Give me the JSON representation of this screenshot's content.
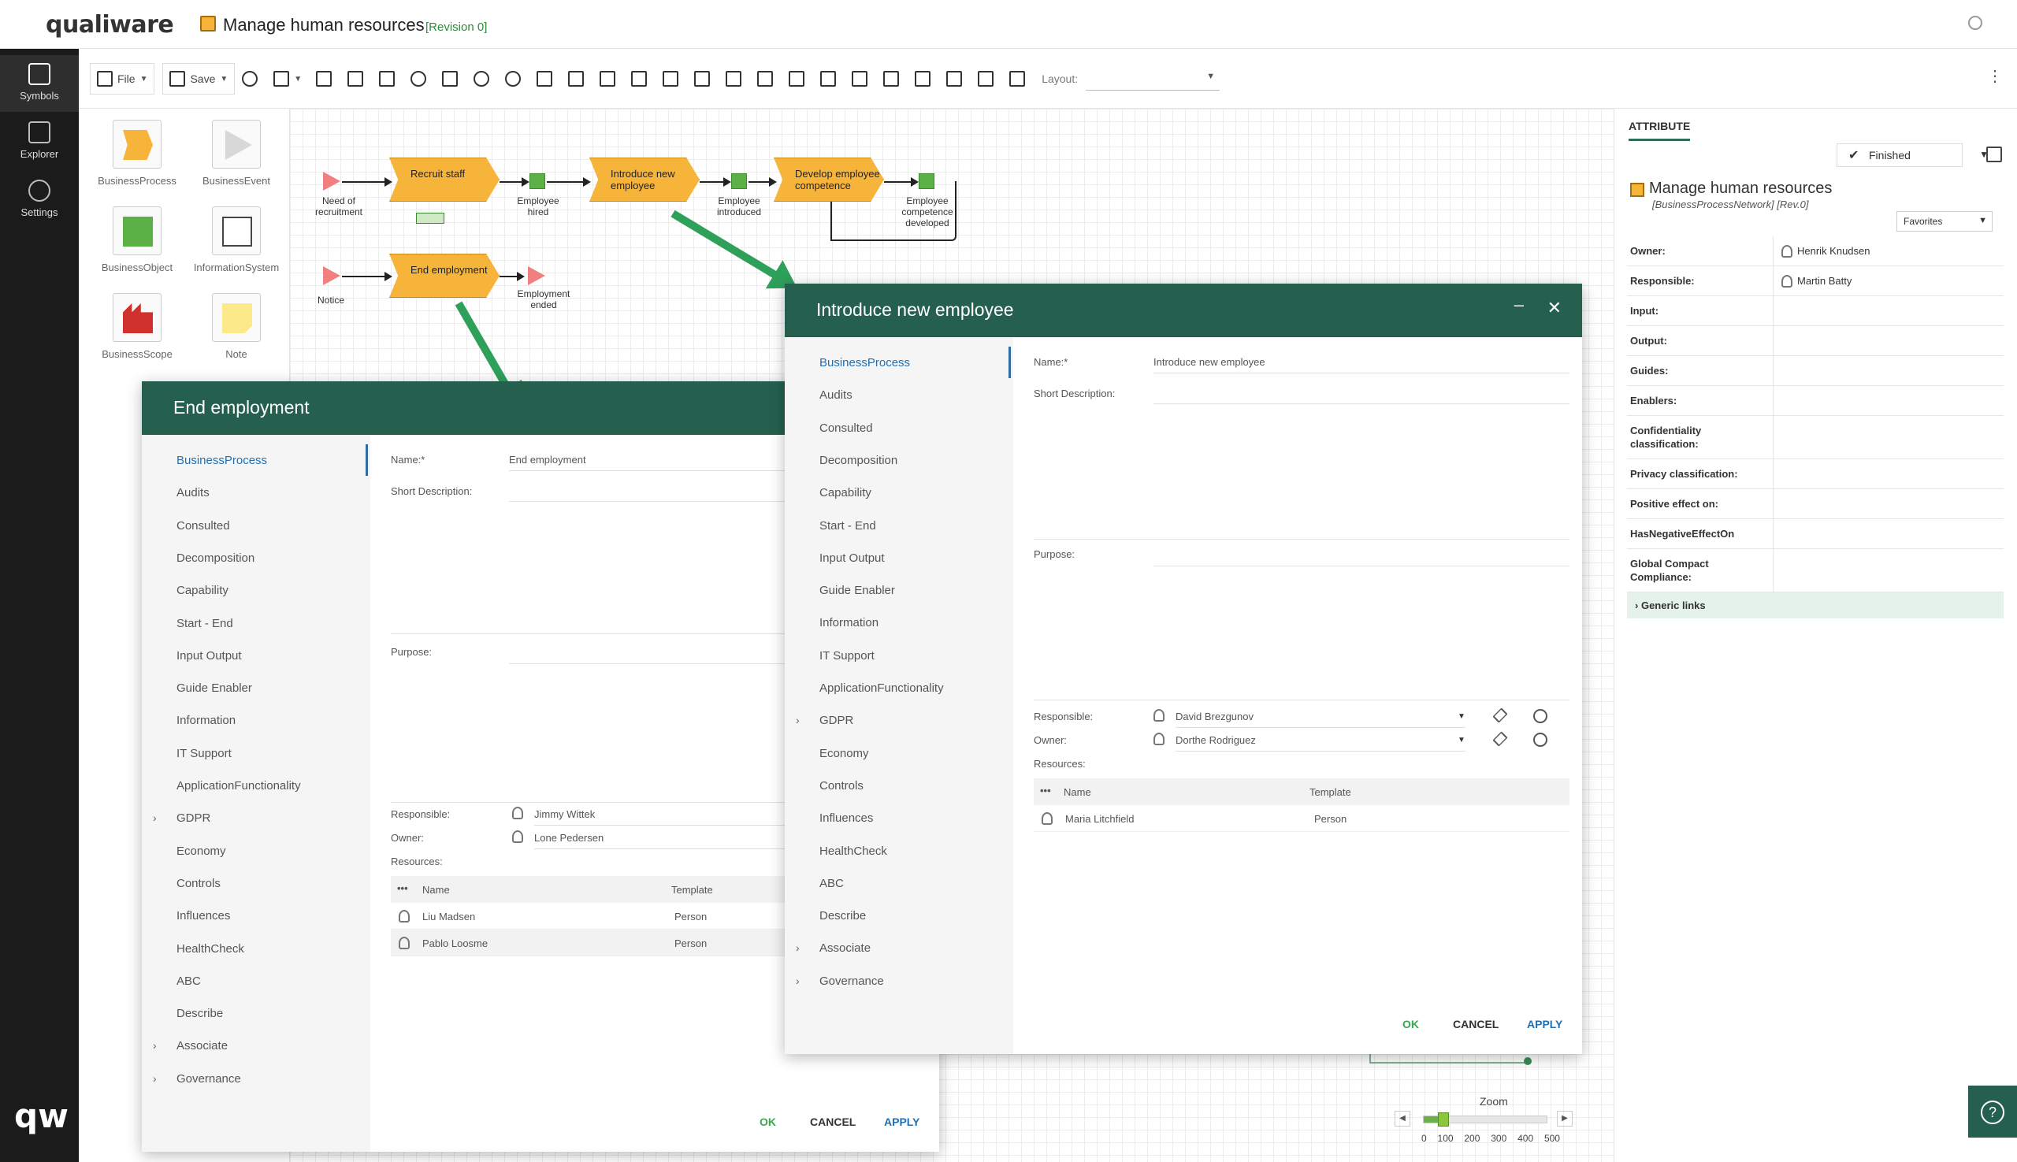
{
  "header": {
    "logo": "qualiware",
    "title": "Manage human resources",
    "revision": "[Revision 0]"
  },
  "rail": {
    "items": [
      {
        "label": "Symbols",
        "icon": "symbols-icon"
      },
      {
        "label": "Explorer",
        "icon": "explorer-icon"
      },
      {
        "label": "Settings",
        "icon": "settings-icon"
      }
    ],
    "brand": "qw"
  },
  "toolbar": {
    "file_label": "File",
    "save_label": "Save",
    "layout_label": "Layout:",
    "layout_value": ""
  },
  "palette": {
    "items": [
      {
        "label": "BusinessProcess"
      },
      {
        "label": "BusinessEvent"
      },
      {
        "label": "BusinessObject"
      },
      {
        "label": "InformationSystem"
      },
      {
        "label": "BusinessScope"
      },
      {
        "label": "Note"
      }
    ]
  },
  "diagram": {
    "processes": [
      "Recruit staff",
      "Introduce new employee",
      "Develop employee competence",
      "End employment"
    ],
    "events": [
      "Need of recruitment",
      "Notice",
      "Employment ended"
    ],
    "objects": [
      "Employee hired",
      "Employee introduced",
      "Employee competence developed"
    ]
  },
  "attribute_panel": {
    "tab": "ATTRIBUTE",
    "status": "Finished",
    "object_name": "Manage human resources",
    "object_type": "[BusinessProcessNetwork] [Rev.0]",
    "favorites": "Favorites",
    "rows": [
      {
        "key": "Owner:",
        "value": "Henrik Knudsen",
        "person": true
      },
      {
        "key": "Responsible:",
        "value": "Martin Batty",
        "person": true
      },
      {
        "key": "Input:",
        "value": ""
      },
      {
        "key": "Output:",
        "value": ""
      },
      {
        "key": "Guides:",
        "value": ""
      },
      {
        "key": "Enablers:",
        "value": ""
      },
      {
        "key": "Confidentiality classification:",
        "value": ""
      },
      {
        "key": "Privacy classification:",
        "value": ""
      },
      {
        "key": "Positive effect on:",
        "value": ""
      },
      {
        "key": "HasNegativeEffectOn",
        "value": ""
      },
      {
        "key": "Global Compact Compliance:",
        "value": ""
      }
    ],
    "generic_links": "Generic links"
  },
  "dialog_end": {
    "title": "End employment",
    "nav": [
      "BusinessProcess",
      "Audits",
      "Consulted",
      "Decomposition",
      "Capability",
      "Start - End",
      "Input Output",
      "Guide Enabler",
      "Information",
      "IT Support",
      "ApplicationFunctionality",
      "GDPR",
      "Economy",
      "Controls",
      "Influences",
      "HealthCheck",
      "ABC",
      "Describe",
      "Associate",
      "Governance"
    ],
    "name_label": "Name:*",
    "name_value": "End employment",
    "short_desc_label": "Short Description:",
    "purpose_label": "Purpose:",
    "responsible_label": "Responsible:",
    "responsible_value": "Jimmy Wittek",
    "owner_label": "Owner:",
    "owner_value": "Lone Pedersen",
    "resources_label": "Resources:",
    "col_name": "Name",
    "col_template": "Template",
    "resources": [
      {
        "name": "Liu Madsen",
        "template": "Person"
      },
      {
        "name": "Pablo Loosme",
        "template": "Person"
      }
    ],
    "ok": "OK",
    "cancel": "CANCEL",
    "apply": "APPLY"
  },
  "dialog_intro": {
    "title": "Introduce new employee",
    "nav": [
      "BusinessProcess",
      "Audits",
      "Consulted",
      "Decomposition",
      "Capability",
      "Start - End",
      "Input Output",
      "Guide Enabler",
      "Information",
      "IT Support",
      "ApplicationFunctionality",
      "GDPR",
      "Economy",
      "Controls",
      "Influences",
      "HealthCheck",
      "ABC",
      "Describe",
      "Associate",
      "Governance"
    ],
    "name_label": "Name:*",
    "name_value": "Introduce new employee",
    "short_desc_label": "Short Description:",
    "purpose_label": "Purpose:",
    "responsible_label": "Responsible:",
    "responsible_value": "David Brezgunov",
    "owner_label": "Owner:",
    "owner_value": "Dorthe Rodriguez",
    "resources_label": "Resources:",
    "col_name": "Name",
    "col_template": "Template",
    "resources": [
      {
        "name": "Maria Litchfield",
        "template": "Person"
      }
    ],
    "ok": "OK",
    "cancel": "CANCEL",
    "apply": "APPLY"
  },
  "zoom": {
    "label": "Zoom",
    "ticks": [
      "0",
      "100",
      "200",
      "300",
      "400",
      "500"
    ],
    "level": 0.16
  },
  "colors": {
    "dialog_header": "#25604f",
    "process": "#f6b43a",
    "object": "#5bb046",
    "event": "#f08080",
    "link_blue": "#1f6fb2",
    "ok_green": "#3aa655"
  }
}
